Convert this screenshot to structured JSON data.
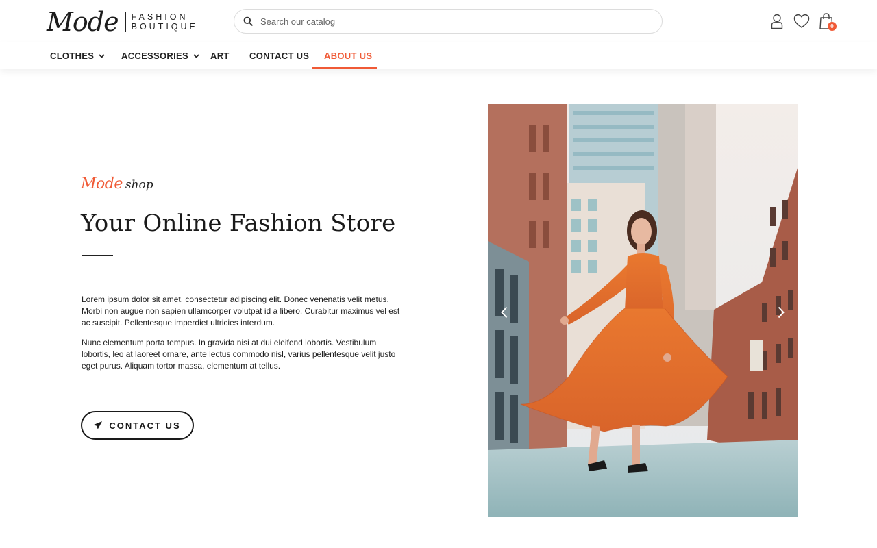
{
  "header": {
    "logo": {
      "script": "Mode",
      "line1": "FASHION",
      "line2": "BOUTIQUE"
    },
    "search": {
      "placeholder": "Search our catalog",
      "value": ""
    },
    "icons": [
      "user-icon",
      "heart-icon",
      "shopping-bag-icon"
    ],
    "cart_count": "0"
  },
  "nav": {
    "items": [
      {
        "label": "CLOTHES",
        "dropdown": true
      },
      {
        "label": "ACCESSORIES",
        "dropdown": true
      },
      {
        "label": "ART",
        "dropdown": false
      },
      {
        "label": "CONTACT US",
        "dropdown": false
      },
      {
        "label": "ABOUT US",
        "dropdown": false,
        "active": true
      }
    ]
  },
  "hero": {
    "tagline_brand": "Mode",
    "tagline_shop": "shop",
    "title": "Your Online Fashion Store",
    "paragraph1": "Lorem ipsum dolor sit amet, consectetur adipiscing elit. Donec venenatis velit metus. Morbi non augue non sapien ullamcorper volutpat id a libero. Curabitur maximus vel est ac suscipit. Pellentesque imperdiet ultricies interdum.",
    "paragraph2": "Nunc elementum porta tempus. In gravida nisi at dui eleifend lobortis. Vestibulum lobortis, leo at laoreet ornare, ante lectus commodo nisl, varius pellentesque velit justo eget purus.  Aliquam tortor massa, elementum at tellus.",
    "button_label": "CONTACT US",
    "button_icon": "paper-plane-icon",
    "image_subject": "woman-in-orange-lace-dress-on-city-street",
    "slider_icons": [
      "chevron-left-icon",
      "chevron-right-icon"
    ]
  },
  "colors": {
    "accent": "#f05a36",
    "text": "#1a1a1a",
    "dress": "#e8742f",
    "brick": "#a45a45",
    "sky": "#e8ecef"
  }
}
